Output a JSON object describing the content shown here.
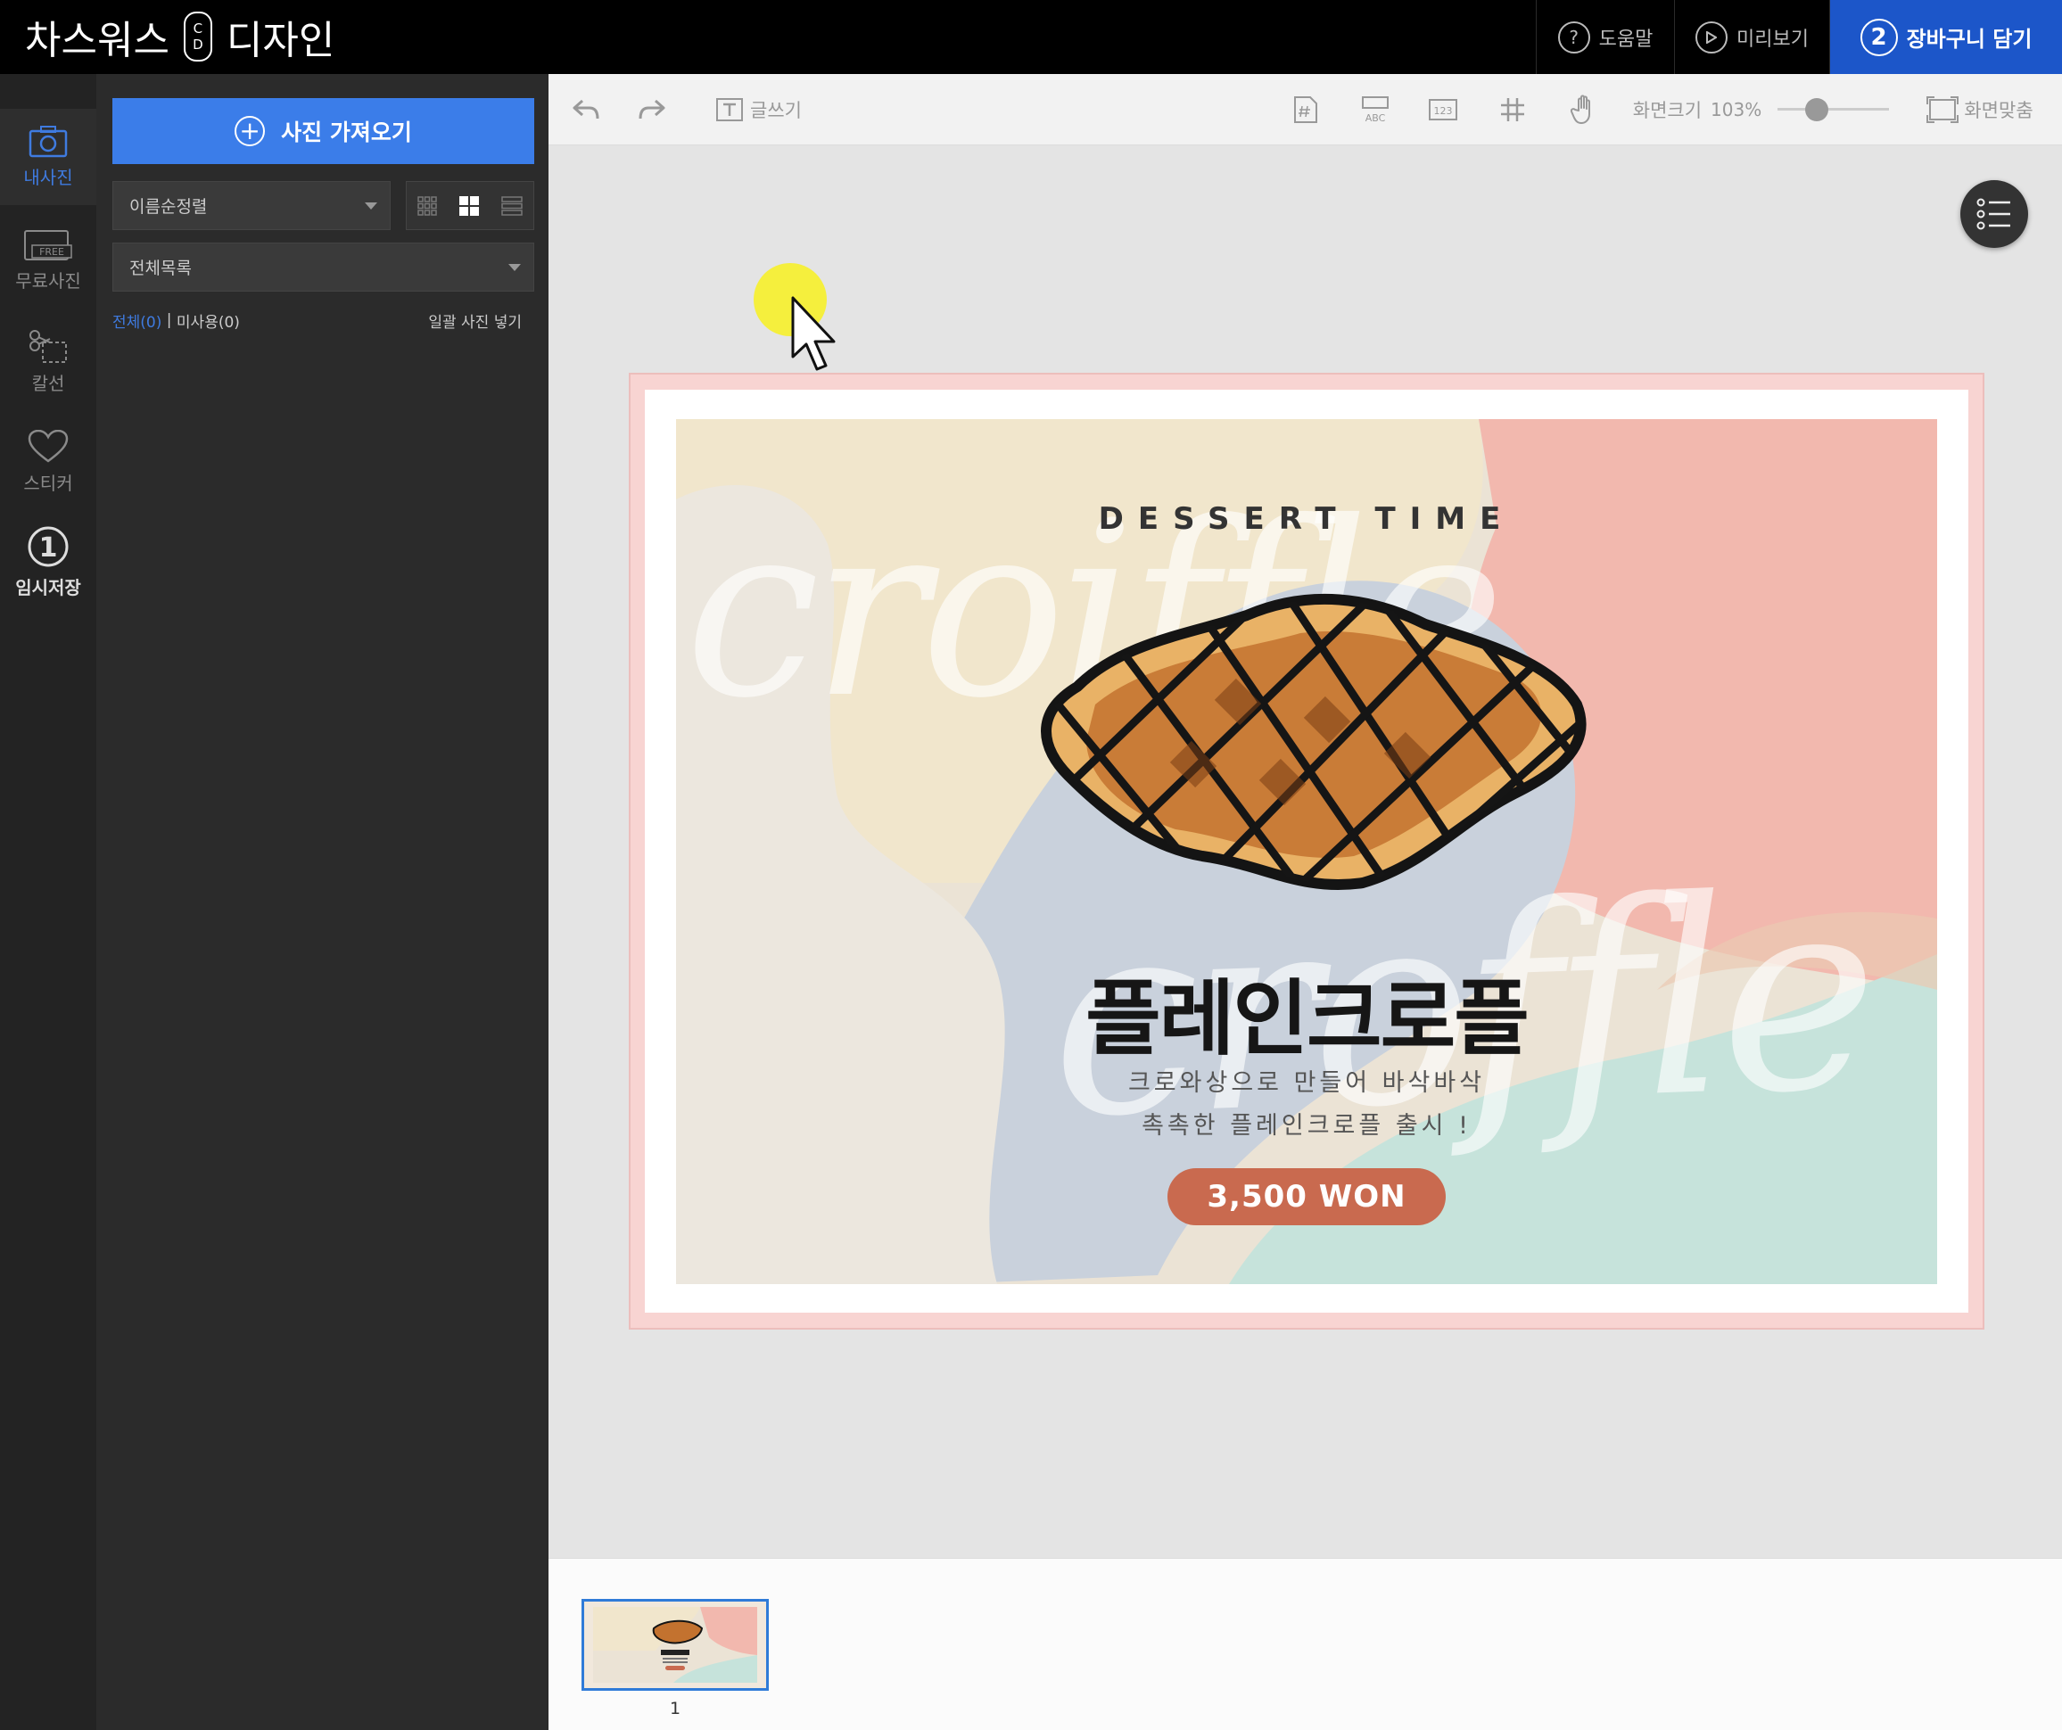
{
  "header": {
    "logo_left": "차스워스",
    "logo_cd_top": "C",
    "logo_cd_bottom": "D",
    "logo_right": "디자인",
    "help": {
      "icon": "question-icon",
      "glyph": "?",
      "label": "도움말"
    },
    "preview": {
      "icon": "play-icon",
      "label": "미리보기"
    },
    "cart": {
      "step": "2",
      "label": "장바구니 담기",
      "color": "#1c56c9"
    }
  },
  "rail": {
    "items": [
      {
        "label": "내사진",
        "icon": "photo-icon",
        "active": true
      },
      {
        "label": "무료사진",
        "icon": "free-photo-icon",
        "badge": "FREE"
      },
      {
        "label": "칼선",
        "icon": "scissors-icon"
      },
      {
        "label": "스티커",
        "icon": "heart-icon"
      },
      {
        "label": "임시저장",
        "icon": "step-one-icon",
        "step": "1"
      }
    ]
  },
  "panel": {
    "import_label": "사진 가져오기",
    "sort_value": "이름순정렬",
    "folder_value": "전체목록",
    "filter_all": "전체(0)",
    "filter_sep": " | ",
    "filter_unused": "미사용(0)",
    "bulk_insert": "일괄 사진 넣기"
  },
  "toolbar": {
    "undo_icon": "undo-icon",
    "redo_icon": "redo-icon",
    "text_label": "글쓰기",
    "zoom_label": "화면크기",
    "zoom_value": "103%",
    "zoom_level": 0.35,
    "fit_label": "화면맞춤"
  },
  "design": {
    "subtitle": "DESSERT TIME",
    "script_top": "croiffle",
    "script_bottom": "croffle",
    "product_name": "플레인크로플",
    "description_line1": "크로와상으로 만들어 바삭바삭",
    "description_line2": "촉촉한 플레인크로플 출시 !",
    "price": "3,500 WON",
    "colors": {
      "frame": "#f8d4d2",
      "peach": "#f2b8ae",
      "cream": "#f1e6cc",
      "blue_gray": "#c9d1dc",
      "mint": "#c6e3db",
      "price_pill": "#c96a4f"
    }
  },
  "pages": [
    {
      "number": "1"
    }
  ]
}
